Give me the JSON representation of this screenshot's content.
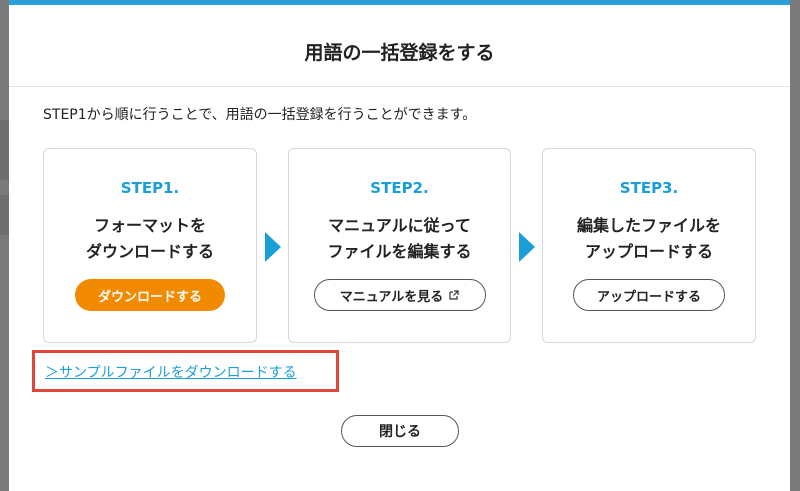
{
  "modal": {
    "title": "用語の一括登録をする",
    "intro": "STEP1から順に行うことで、用語の一括登録を行うことができます。",
    "close_label": "閉じる",
    "sample_link": "＞サンプルファイルをダウンロードする"
  },
  "steps": [
    {
      "step": "STEP1.",
      "desc_line1": "フォーマットを",
      "desc_line2": "ダウンロードする",
      "button": "ダウンロードする"
    },
    {
      "step": "STEP2.",
      "desc_line1": "マニュアルに従って",
      "desc_line2": "ファイルを編集する",
      "button": "マニュアルを見る"
    },
    {
      "step": "STEP3.",
      "desc_line1": "編集したファイルを",
      "desc_line2": "アップロードする",
      "button": "アップロードする"
    }
  ],
  "colors": {
    "accent": "#1a9ed8",
    "primary_button": "#f28a00",
    "highlight_border": "#e0453c"
  },
  "icons": {
    "external_link": "external-link-icon",
    "step_arrow": "chevron-right-icon"
  }
}
